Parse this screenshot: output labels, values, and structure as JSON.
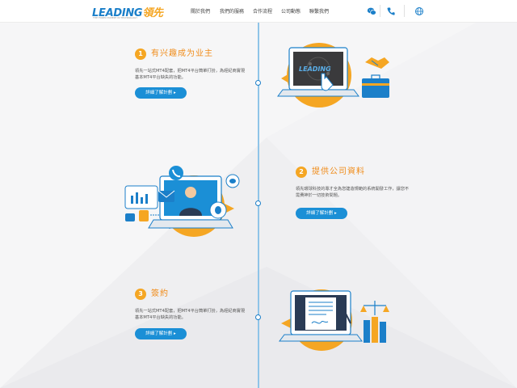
{
  "header": {
    "logo_text_main": "LEADING",
    "logo_text_cn": "領先",
    "logo_tagline": "THE FOREX EXPERT IN TECHNOLOGY",
    "nav": [
      {
        "label": "關於我們"
      },
      {
        "label": "我們的服務"
      },
      {
        "label": "合作流程"
      },
      {
        "label": "公司動態"
      },
      {
        "label": "聯繫我們"
      }
    ],
    "icons": [
      "wechat-icon",
      "phone-icon",
      "globe-icon"
    ]
  },
  "steps": [
    {
      "num": "1",
      "title": "有兴趣成为业主",
      "desc": "領先一站式MT4配套，把MT4平台簡單打扮，為經紀商實現基本MT4平台缺失的功能。",
      "button": "詳細了解計劃 ▸"
    },
    {
      "num": "2",
      "title": "提供公司資料",
      "desc": "領先環球科技的專才全為您建造規範的系統開發工作，讓您不需費神於一切技術問題。",
      "button": "詳細了解計劃 ▸"
    },
    {
      "num": "3",
      "title": "簽約",
      "desc": "領先一站式MT4配套，把MT4平台簡單打扮，為經紀商實現基本MT4平台缺失的功能。",
      "button": "詳細了解計劃 ▸"
    }
  ],
  "illustration_labels": {
    "laptop_screen_logo": "LEADING領先"
  },
  "colors": {
    "brand_blue": "#1b7fc9",
    "accent_orange": "#f5a623",
    "button_blue": "#1b8fd6",
    "title_orange": "#f08c1a"
  }
}
